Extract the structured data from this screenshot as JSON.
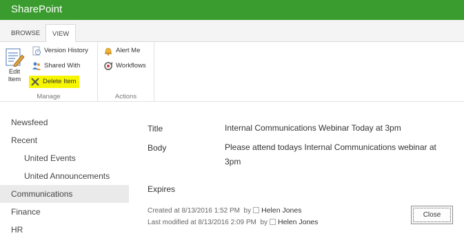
{
  "suite_bar": {
    "brand": "SharePoint",
    "color": "#3a9c2e"
  },
  "ribbon_tabs": [
    {
      "label": "BROWSE"
    },
    {
      "label": "VIEW",
      "selected": true
    }
  ],
  "ribbon": {
    "manage": {
      "label": "Manage",
      "edit_item": {
        "label_line1": "Edit",
        "label_line2": "Item",
        "icon": "edit-item-icon"
      },
      "version_history": {
        "label": "Version History",
        "icon": "version-history-icon"
      },
      "shared_with": {
        "label": "Shared With",
        "icon": "shared-with-icon"
      },
      "delete_item": {
        "label": "Delete Item",
        "icon": "delete-x-icon",
        "highlighted": true,
        "highlight_color": "#f6f600"
      }
    },
    "actions": {
      "label": "Actions",
      "alert_me": {
        "label": "Alert Me",
        "icon": "bell-icon"
      },
      "workflows": {
        "label": "Workflows",
        "icon": "workflows-icon"
      }
    }
  },
  "left_nav": [
    {
      "label": "Newsfeed",
      "level": 0
    },
    {
      "label": "Recent",
      "level": 0
    },
    {
      "label": "United Events",
      "level": 1
    },
    {
      "label": "United Announcements",
      "level": 1
    },
    {
      "label": "Communications",
      "level": 0,
      "selected": true
    },
    {
      "label": "Finance",
      "level": 0
    },
    {
      "label": "HR",
      "level": 0
    }
  ],
  "item": {
    "fields": [
      {
        "name": "Title",
        "value": "Internal Communications Webinar Today at 3pm"
      },
      {
        "name": "Body",
        "value": "Please attend todays Internal Communications webinar at 3pm"
      },
      {
        "name": "Expires",
        "value": ""
      }
    ],
    "created": {
      "prefix": "Created at 8/13/2016 1:52 PM",
      "by": "by",
      "user": "Helen Jones"
    },
    "modified": {
      "prefix": "Last modified at 8/13/2016 2:09 PM",
      "by": "by",
      "user": "Helen Jones"
    },
    "close_label": "Close"
  }
}
